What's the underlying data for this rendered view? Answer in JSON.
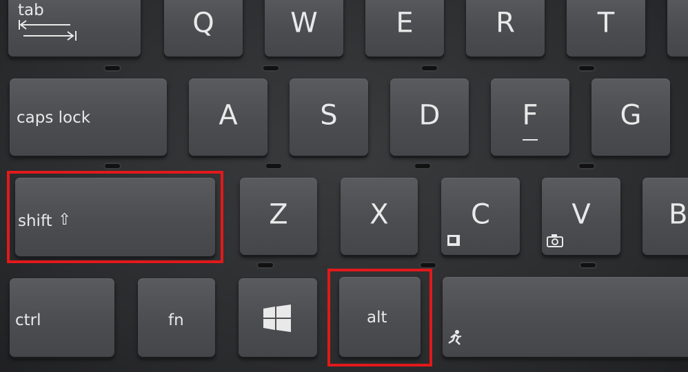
{
  "keys": {
    "tab": "tab",
    "q": "Q",
    "w": "W",
    "e": "E",
    "r": "R",
    "t": "T",
    "caps_lock": "caps lock",
    "a": "A",
    "s": "S",
    "d": "D",
    "f": "F",
    "g": "G",
    "shift": "shift",
    "shift_symbol": "⇧",
    "z": "Z",
    "x": "X",
    "c": "C",
    "v": "V",
    "b": "B",
    "ctrl": "ctrl",
    "fn": "fn",
    "alt": "alt"
  },
  "highlight_color": "#e2191b"
}
